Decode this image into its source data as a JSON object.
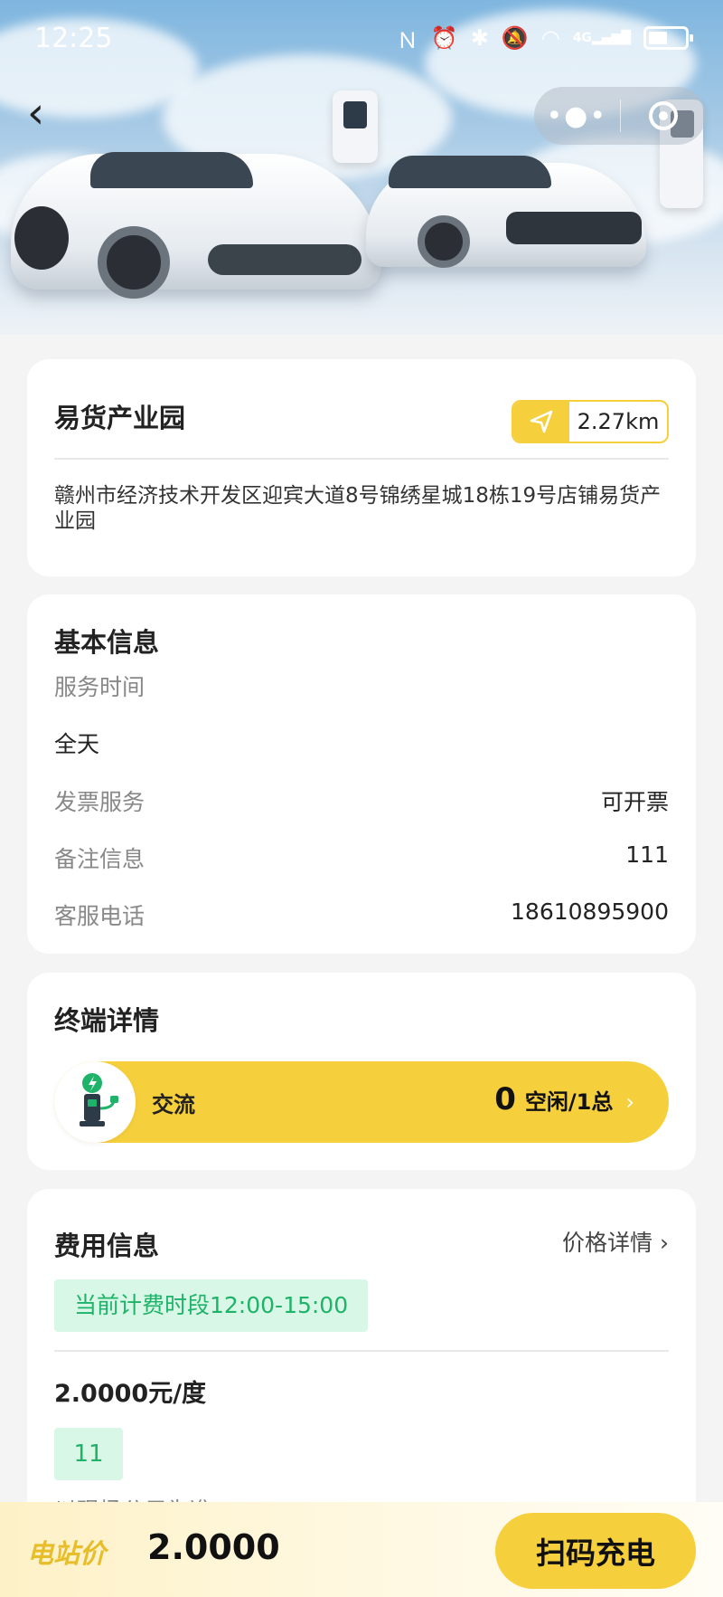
{
  "status_bar": {
    "time": "12:25",
    "network": "4G"
  },
  "station": {
    "name": "易货产业园",
    "distance": "2.27km",
    "address": "赣州市经济技术开发区迎宾大道8号锦绣星城18栋19号店铺易货产业园"
  },
  "basic_info": {
    "title": "基本信息",
    "service_time_label": "服务时间",
    "service_time_value": "全天",
    "invoice_label": "发票服务",
    "invoice_value": "可开票",
    "remark_label": "备注信息",
    "remark_value": "111",
    "phone_label": "客服电话",
    "phone_value": "18610895900"
  },
  "terminal": {
    "title": "终端详情",
    "type": "交流",
    "count": "0",
    "count_suffix": "空闲/1总"
  },
  "fee": {
    "title": "费用信息",
    "price_detail_link": "价格详情",
    "current_period": "当前计费时段12:00-15:00",
    "price": "2.0000元/度",
    "tag": "11",
    "cut_text": "以现场公示为准"
  },
  "bottom": {
    "label": "电站价",
    "price": "2.0000",
    "scan_button": "扫码充电"
  },
  "colors": {
    "accent": "#f6cf3c",
    "green": "#1fb36a",
    "green_bg": "#d9f7e6"
  }
}
